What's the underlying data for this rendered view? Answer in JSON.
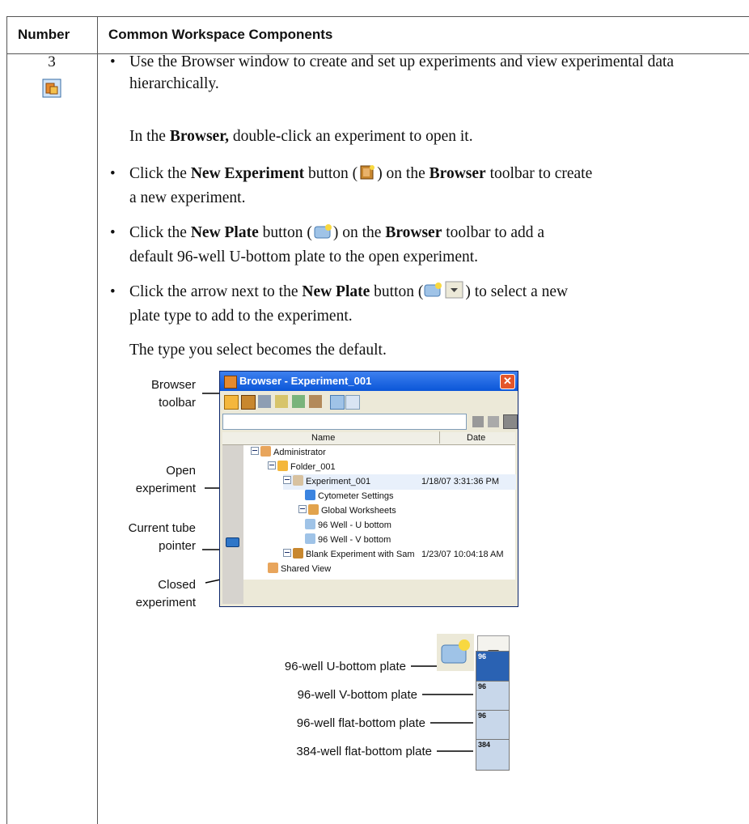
{
  "table": {
    "header_number": "Number",
    "header_components": "Common Workspace Components",
    "row_number": "3"
  },
  "content": {
    "p1": "Use the Browser window to create and set up experiments and view experimental data hierarchically.",
    "p2_a": "In the ",
    "p2_b": "Browser,",
    "p2_c": " double-click an experiment to open it.",
    "p3_a": "Click the ",
    "p3_b": "New Experiment",
    "p3_c": " button (",
    "p3_d": ") on the ",
    "p3_e": "Browser",
    "p3_f": " toolbar to create",
    "p3_g": "a new experiment.",
    "p4_a": "Click the ",
    "p4_b": "New Plate",
    "p4_c": " button (",
    "p4_d": ") on the ",
    "p4_e": "Browser",
    "p4_f": " toolbar to add a",
    "p4_g": "default 96-well U-bottom plate to the open experiment.",
    "p5_a": "Click the arrow next to the ",
    "p5_b": "New Plate",
    "p5_c": " button (",
    "p5_d": ") to select a new",
    "p5_e": "plate type to add to the experiment.",
    "p6": "The type you select becomes the default."
  },
  "callouts": {
    "browser_toolbar_1": "Browser",
    "browser_toolbar_2": "toolbar",
    "open_exp_1": "Open",
    "open_exp_2": "experiment",
    "tube_1": "Current tube",
    "tube_2": "pointer",
    "closed_1": "Closed",
    "closed_2": "experiment"
  },
  "browser": {
    "title": "Browser - Experiment_001",
    "col_name": "Name",
    "col_date": "Date",
    "items": [
      {
        "label": "Administrator",
        "date": ""
      },
      {
        "label": "Folder_001",
        "date": ""
      },
      {
        "label": "Experiment_001",
        "date": "1/18/07 3:31:36 PM"
      },
      {
        "label": "Cytometer Settings",
        "date": ""
      },
      {
        "label": "Global Worksheets",
        "date": ""
      },
      {
        "label": "96 Well - U bottom",
        "date": ""
      },
      {
        "label": "96 Well - V bottom",
        "date": ""
      },
      {
        "label": "Blank Experiment with Sam",
        "date": "1/23/07 10:04:18 AM"
      },
      {
        "label": "Shared View",
        "date": ""
      }
    ]
  },
  "plates": {
    "labels": [
      "96-well U-bottom plate",
      "96-well V-bottom plate",
      "96-well flat-bottom plate",
      "384-well flat-bottom plate"
    ],
    "codes": [
      "96",
      "96",
      "96",
      "384"
    ]
  }
}
